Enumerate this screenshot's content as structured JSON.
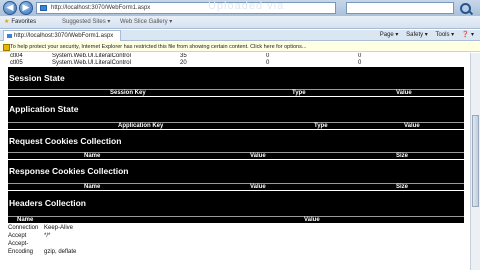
{
  "browser": {
    "url": "http://localhost:3070/WebForm1.aspx",
    "watermark": "Uploaded via",
    "back_icon": "back-arrow-icon",
    "forward_icon": "forward-arrow-icon",
    "favorites_label": "Favorites",
    "suggested_label": "Suggested Sites ▾",
    "gallery_label": "Web Slice Gallery ▾",
    "tab_title": "http://localhost:3070/WebForm1.aspx",
    "tools": [
      "Page ▾",
      "Safety ▾",
      "Tools ▾",
      "❓ ▾"
    ],
    "infobar_text": "To help protect your security, Internet Explorer has restricted this file from showing certain content. Click here for options..."
  },
  "control_tree_rows": [
    {
      "id": "ctl04",
      "type": "System.Web.UI.LiteralControl",
      "render": "35",
      "viewstate": "0",
      "controlstate": "0"
    },
    {
      "id": "ctl05",
      "type": "System.Web.UI.LiteralControl",
      "render": "20",
      "viewstate": "0",
      "controlstate": "0"
    }
  ],
  "sections": {
    "session": {
      "title": "Session State",
      "cols": [
        "Session Key",
        "Type",
        "Value"
      ]
    },
    "application": {
      "title": "Application State",
      "cols": [
        "Application Key",
        "Type",
        "Value"
      ]
    },
    "request_cookies": {
      "title": "Request Cookies Collection",
      "cols": [
        "Name",
        "Value",
        "Size"
      ]
    },
    "response_cookies": {
      "title": "Response Cookies Collection",
      "cols": [
        "Name",
        "Value",
        "Size"
      ]
    },
    "headers": {
      "title": "Headers Collection",
      "cols": [
        "Name",
        "Value"
      ]
    }
  },
  "header_rows": [
    {
      "name": "Connection",
      "value": "Keep-Alive"
    },
    {
      "name": "Accept",
      "value": "*/*"
    },
    {
      "name": "Accept-",
      "value": ""
    },
    {
      "name": "Encoding",
      "value": "gzip, deflate"
    }
  ]
}
